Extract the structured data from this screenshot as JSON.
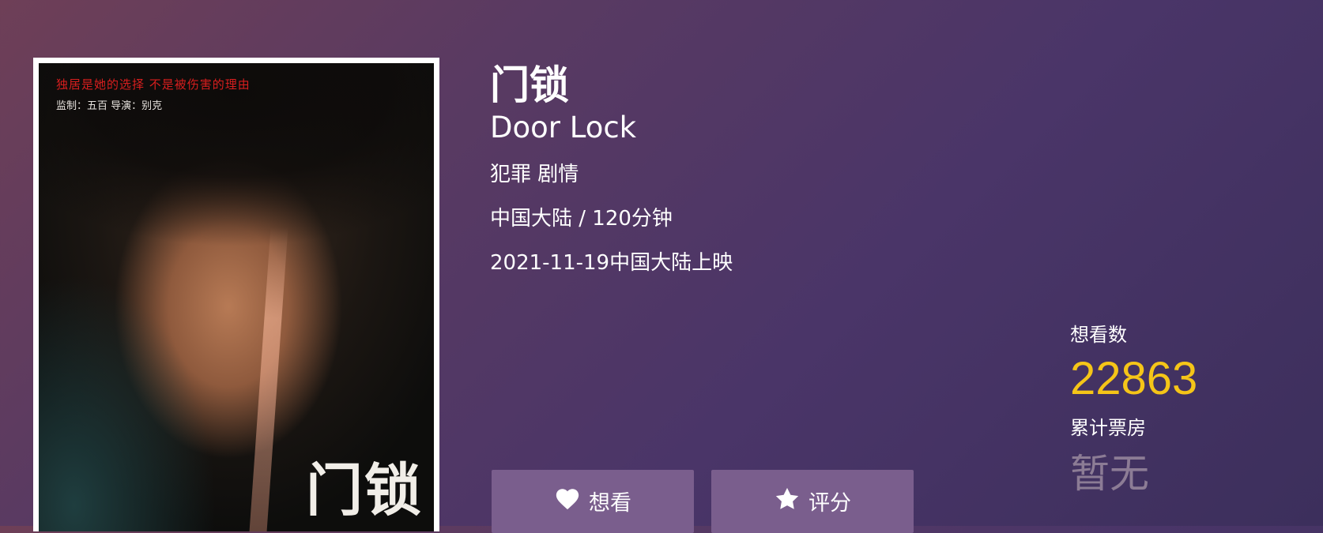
{
  "movie": {
    "title_cn": "门锁",
    "title_en": "Door Lock",
    "genres": "犯罪 剧情",
    "region_duration": "中国大陆 / 120分钟",
    "release": "2021-11-19中国大陆上映"
  },
  "poster": {
    "tagline": "独居是她的选择 不是被伤害的理由",
    "credits": "监制：五百    导演：别克",
    "title": "门锁"
  },
  "actions": {
    "want_label": "想看",
    "rate_label": "评分",
    "want_icon": "heart-icon",
    "rate_icon": "star-icon"
  },
  "stats": {
    "want_count_label": "想看数",
    "want_count": "22863",
    "box_office_label": "累计票房",
    "box_office": "暂无"
  },
  "colors": {
    "accent": "#f5c518",
    "button_bg": "#7a5e8d",
    "muted": "#8c7c95"
  }
}
